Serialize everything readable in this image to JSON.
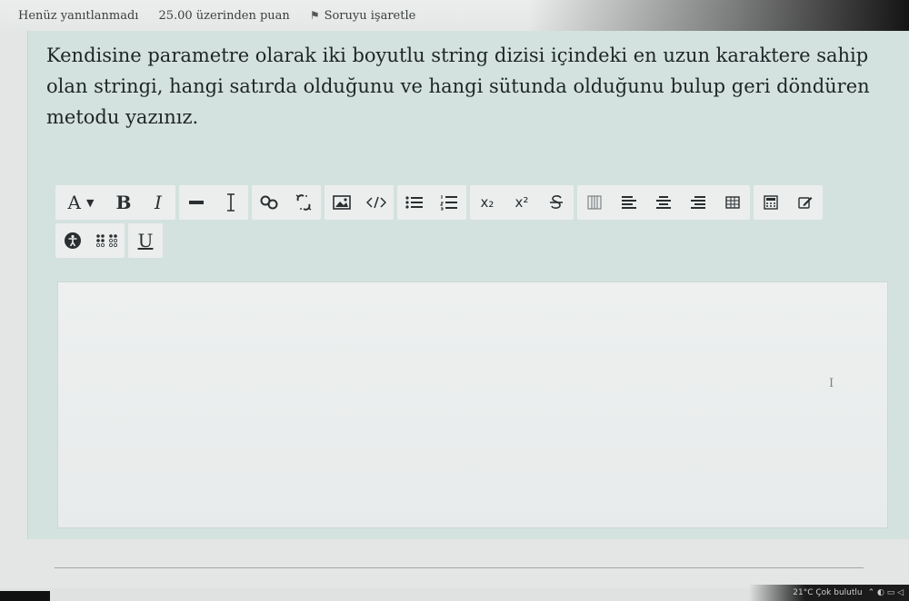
{
  "header": {
    "status": "Henüz yanıtlanmadı",
    "points": "25.00 üzerinden puan",
    "flag_label": "Soruyu işaretle",
    "flag_icon": "flag-icon"
  },
  "question": {
    "text": "Kendisine parametre olarak iki boyutlu string dizisi içindeki en uzun karaktere sahip olan stringi, hangi satırda olduğunu ve hangi sütunda olduğunu bulup  geri döndüren metodu yazınız."
  },
  "toolbar": {
    "font_label": "A",
    "bold_label": "B",
    "italic_label": "I",
    "subscript_label": "x₂",
    "superscript_label": "x²",
    "underline_label": "U",
    "icons": [
      "font-menu-icon",
      "bold-icon",
      "italic-icon",
      "horizontal-rule-icon",
      "cursor-text-icon",
      "link-icon",
      "unlink-icon",
      "image-icon",
      "code-icon",
      "bullet-list-icon",
      "numbered-list-icon",
      "subscript-icon",
      "superscript-icon",
      "strikethrough-icon",
      "table-columns-icon",
      "align-left-icon",
      "align-center-icon",
      "align-right-icon",
      "table-icon",
      "calculator-icon",
      "edit-icon",
      "accessibility-icon",
      "braille-icon",
      "underline-icon"
    ]
  },
  "editor": {
    "value": ""
  },
  "taskbar": {
    "weather": "21°C  Çok bulutlu"
  }
}
